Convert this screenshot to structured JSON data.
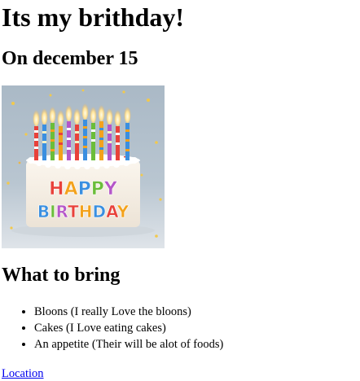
{
  "page": {
    "title": "Its my brithday!",
    "subtitle": "On december 15",
    "section_heading": "What to bring",
    "items": [
      "Bloons (I really Love the bloons)",
      "Cakes (I Love eating cakes)",
      "An appetite (Their will be alot of foods)"
    ],
    "link_label": "Location"
  },
  "image": {
    "top_text": "HAPPY",
    "bottom_text": "BIRTHDAY",
    "letter_colors": [
      "#e8413a",
      "#f3a21c",
      "#3a8fe0",
      "#6bbd3a",
      "#b556c8",
      "#e8413a",
      "#f3a21c",
      "#3a8fe0"
    ]
  },
  "colors": {
    "link": "#0000ee",
    "text": "#000000"
  }
}
